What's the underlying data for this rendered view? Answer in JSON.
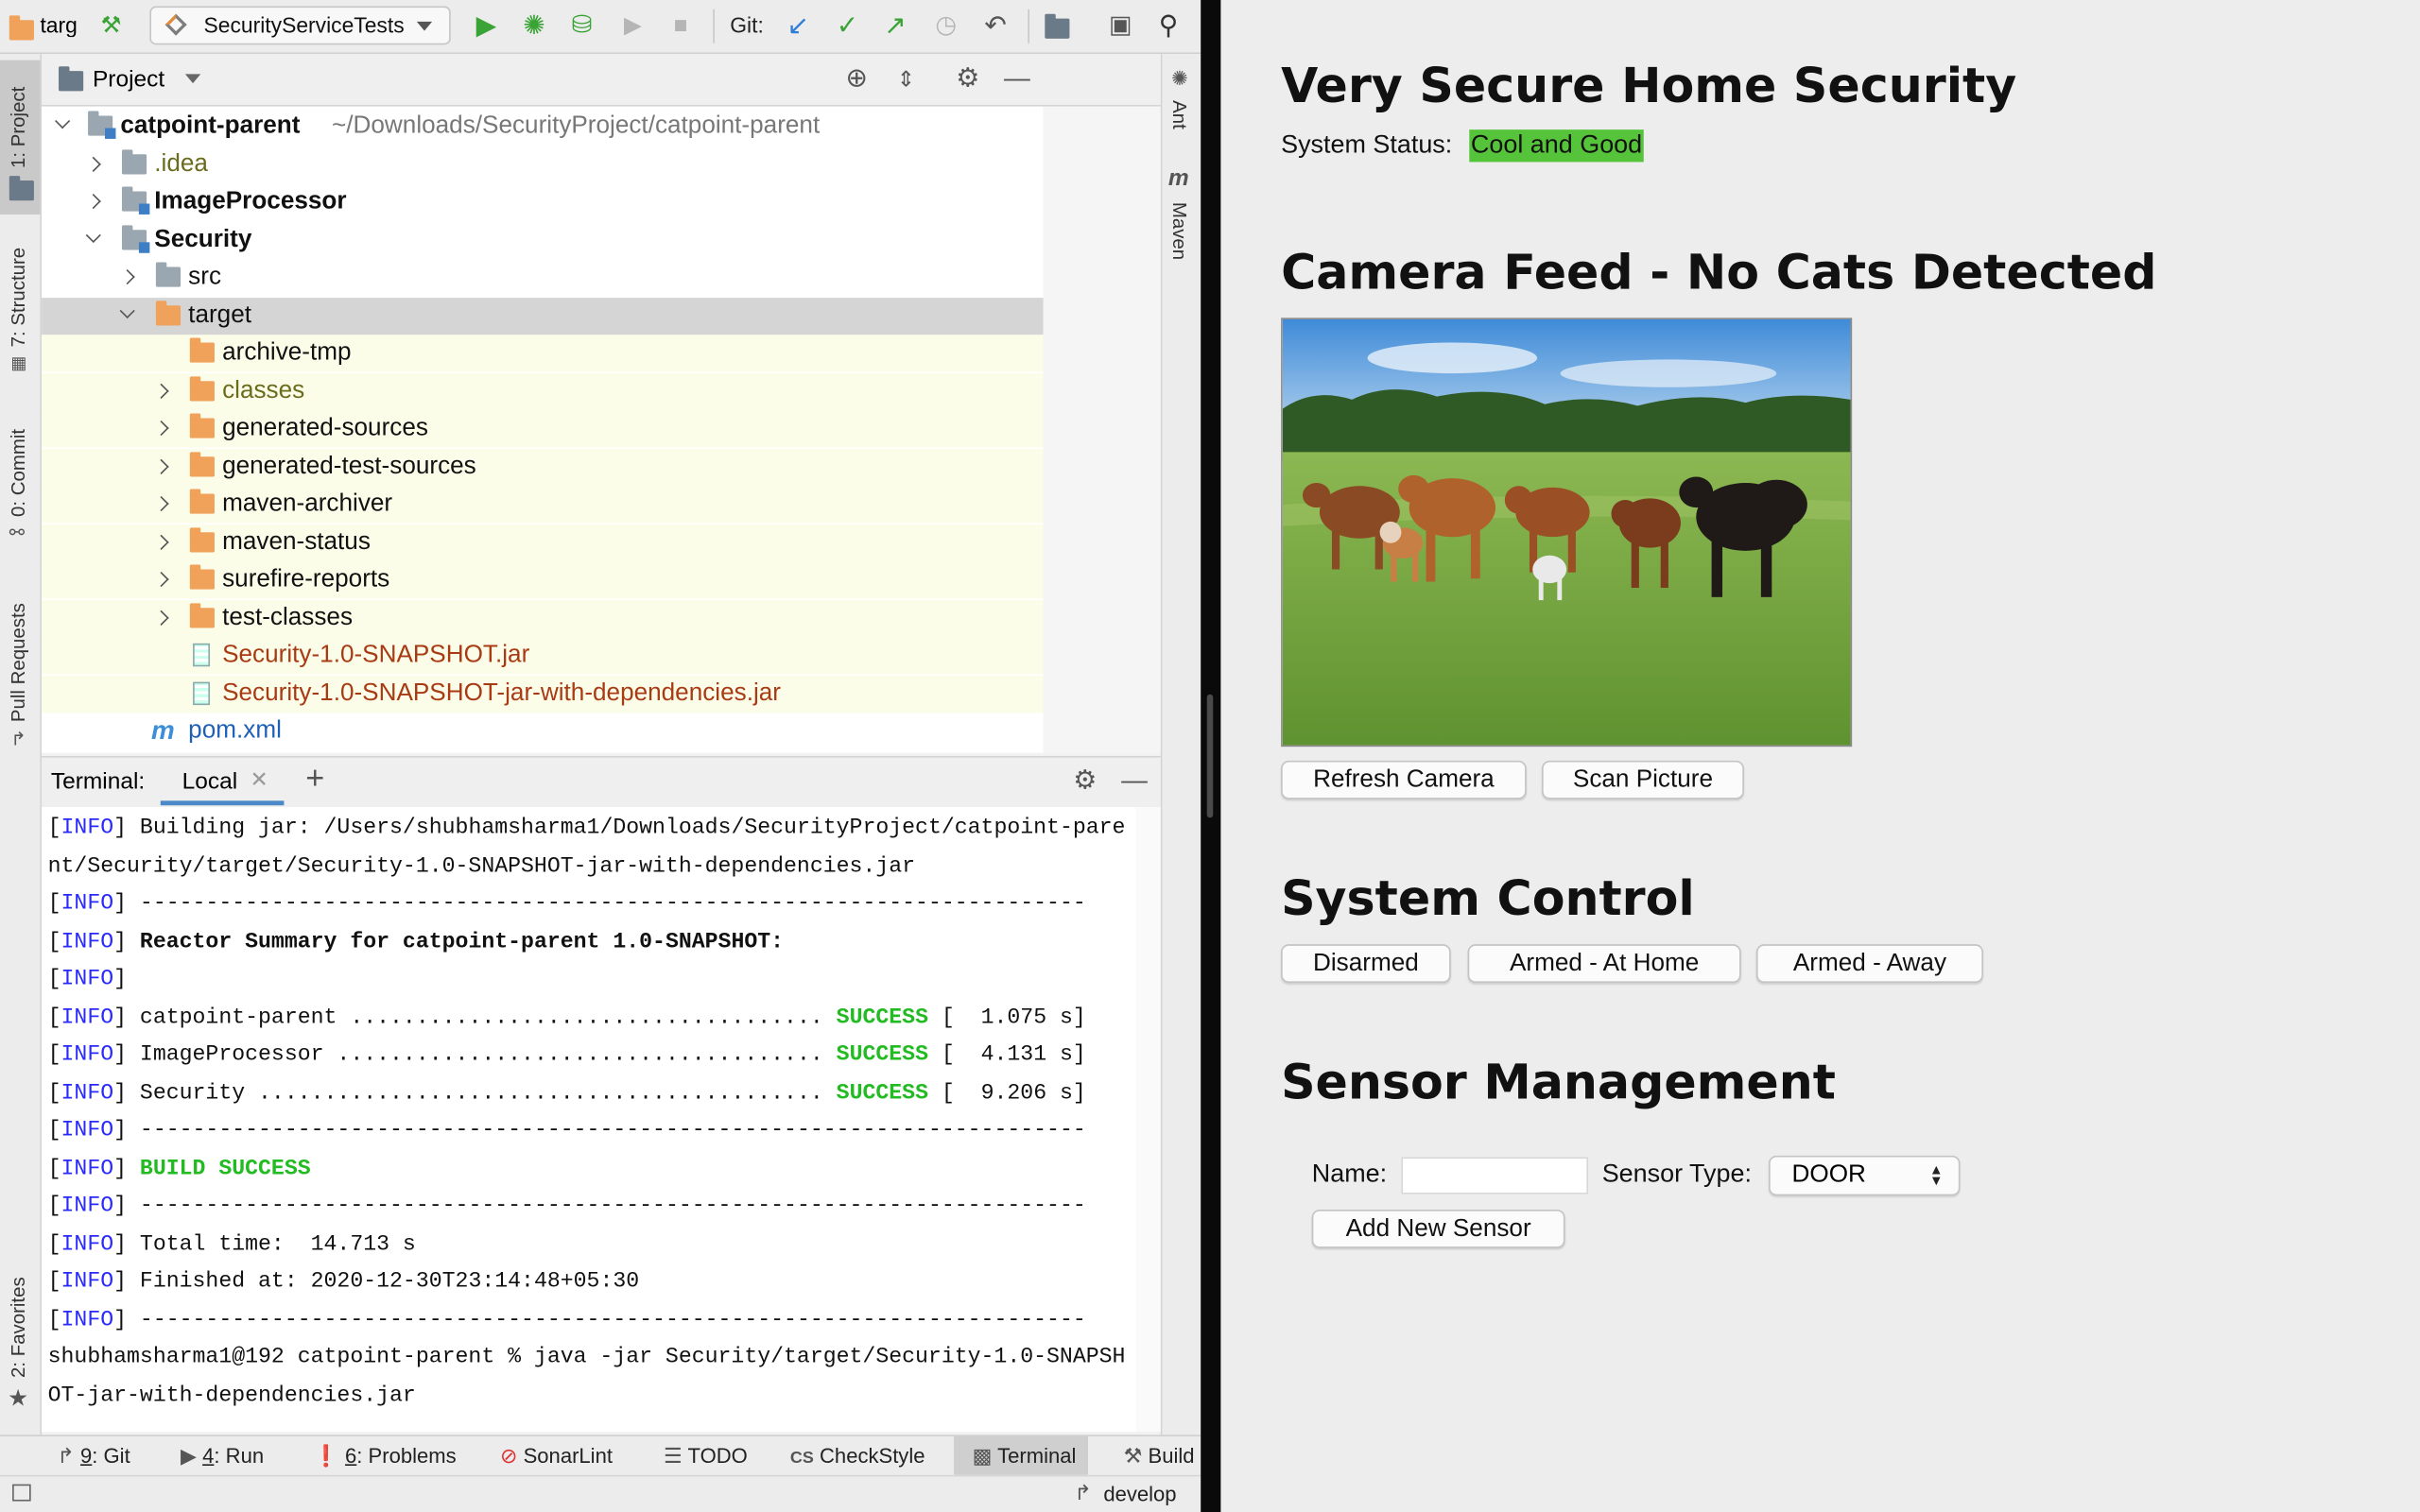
{
  "ide": {
    "toolbar": {
      "project_crumb": "targ",
      "run_config": "SecurityServiceTests",
      "git_label": "Git:"
    },
    "left_tabs": [
      "1: Project",
      "7: Structure",
      "0: Commit",
      "Pull Requests",
      "2: Favorites"
    ],
    "right_tabs": [
      "Ant",
      "Maven"
    ],
    "project_panel": {
      "title": "Project",
      "root_name": "catpoint-parent",
      "root_path": "~/Downloads/SecurityProject/catpoint-parent",
      "items": {
        "idea": ".idea",
        "image_processor": "ImageProcessor",
        "security": "Security",
        "src": "src",
        "target": "target",
        "archive_tmp": "archive-tmp",
        "classes": "classes",
        "generated_sources": "generated-sources",
        "generated_test_sources": "generated-test-sources",
        "maven_archiver": "maven-archiver",
        "maven_status": "maven-status",
        "surefire_reports": "surefire-reports",
        "test_classes": "test-classes",
        "jar1": "Security-1.0-SNAPSHOT.jar",
        "jar2": "Security-1.0-SNAPSHOT-jar-with-dependencies.jar",
        "pom": "pom.xml"
      }
    },
    "terminal": {
      "label": "Terminal:",
      "tab": "Local",
      "info_tag": "INFO",
      "lines": {
        "l1_rest": "Building jar: /Users/shubhamsharma1/Downloads/SecurityProject/catpoint-pare",
        "l2": "nt/Security/target/Security-1.0-SNAPSHOT-jar-with-dependencies.jar",
        "dashes": "------------------------------------------------------------------------",
        "reactor": "Reactor Summary for catpoint-parent 1.0-SNAPSHOT:",
        "r1_name": "catpoint-parent ....................................",
        "r1_time": "[  1.075 s]",
        "r2_name": "ImageProcessor .....................................",
        "r2_time": "[  4.131 s]",
        "r3_name": "Security ...........................................",
        "r3_time": "[  9.206 s]",
        "success": "SUCCESS",
        "build_success": "BUILD SUCCESS",
        "total_time": "Total time:  14.713 s",
        "finished_at": "Finished at: 2020-12-30T23:14:48+05:30",
        "prompt1": "shubhamsharma1@192 catpoint-parent % java -jar Security/target/Security-1.0-SNAPSH",
        "prompt2": "OT-jar-with-dependencies.jar"
      }
    },
    "tool_windows": {
      "git_num": "9",
      "git": ": Git",
      "run_num": "4",
      "run": ": Run",
      "problems_num": "6",
      "problems": ": Problems",
      "sonarlint": "SonarLint",
      "todo": "TODO",
      "checkstyle": "CheckStyle",
      "terminal": "Terminal",
      "build": "Build"
    },
    "status_bar": {
      "branch": "develop"
    }
  },
  "app": {
    "title": "Very Secure Home Security",
    "status_label": "System Status:",
    "status_value": "Cool and Good",
    "status_color": "#56c43a",
    "camera_heading": "Camera Feed - No Cats Detected",
    "refresh_button": "Refresh Camera",
    "scan_button": "Scan Picture",
    "control_heading": "System Control",
    "arming_buttons": [
      "Disarmed",
      "Armed - At Home",
      "Armed - Away"
    ],
    "sensor_heading": "Sensor Management",
    "name_label": "Name:",
    "name_value": "",
    "type_label": "Sensor Type:",
    "type_selected": "DOOR",
    "add_sensor_button": "Add New Sensor"
  }
}
